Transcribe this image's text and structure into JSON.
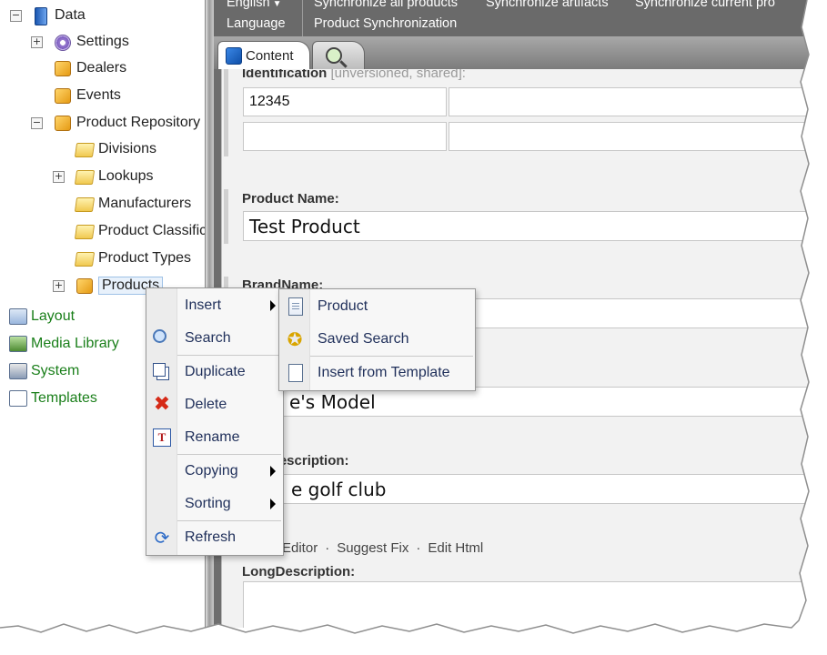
{
  "tree": {
    "items": [
      {
        "label": "Data",
        "icon": "database-icon"
      },
      {
        "label": "Settings",
        "icon": "settings-icon"
      },
      {
        "label": "Dealers",
        "icon": "package-icon"
      },
      {
        "label": "Events",
        "icon": "package-icon"
      },
      {
        "label": "Product Repository",
        "icon": "package-icon"
      },
      {
        "label": "Divisions",
        "icon": "folder-icon"
      },
      {
        "label": "Lookups",
        "icon": "folder-icon"
      },
      {
        "label": "Manufacturers",
        "icon": "folder-icon"
      },
      {
        "label": "Product Classific",
        "icon": "folder-icon"
      },
      {
        "label": "Product Types",
        "icon": "folder-icon"
      },
      {
        "label": "Products",
        "icon": "package-icon"
      }
    ],
    "roots": [
      {
        "label": "Layout",
        "icon": "layout-icon"
      },
      {
        "label": "Media Library",
        "icon": "media-library-icon"
      },
      {
        "label": "System",
        "icon": "system-icon"
      },
      {
        "label": "Templates",
        "icon": "templates-icon"
      }
    ]
  },
  "toolbar": {
    "language_value": "English",
    "sync_all": "Synchronize all products",
    "sync_artifacts": "Synchronize artifacts",
    "sync_current": "Synchronize current pro",
    "group_language": "Language",
    "group_product_sync": "Product Synchronization"
  },
  "tabs": {
    "content": "Content"
  },
  "form": {
    "identification_label": "Identification",
    "identification_note": "[unversioned, shared]:",
    "identification_value": "12345",
    "product_name_label": "Product Name:",
    "product_name_value": "Test Product",
    "brandname_label": "BrandName:",
    "model_partial_value": "e's Model",
    "description_label_partial": "Description:",
    "description_partial_value": "e golf club",
    "editor_links": [
      "Editor",
      "Suggest Fix",
      "Edit Html"
    ],
    "long_description_label": "LongDescription:"
  },
  "context_menu": {
    "items": [
      {
        "label": "Insert",
        "icon": "",
        "submenu": true
      },
      {
        "label": "Search",
        "icon": "search-icon",
        "submenu": false
      },
      {
        "label": "Duplicate",
        "icon": "duplicate-icon",
        "submenu": false
      },
      {
        "label": "Delete",
        "icon": "delete-icon",
        "submenu": false
      },
      {
        "label": "Rename",
        "icon": "rename-icon",
        "submenu": false
      },
      {
        "label": "Copying",
        "icon": "",
        "submenu": true
      },
      {
        "label": "Sorting",
        "icon": "",
        "submenu": true
      },
      {
        "label": "Refresh",
        "icon": "refresh-icon",
        "submenu": false
      }
    ]
  },
  "insert_submenu": {
    "items": [
      {
        "label": "Product",
        "icon": "document-icon"
      },
      {
        "label": "Saved Search",
        "icon": "saved-search-icon"
      },
      {
        "label": "Insert from Template",
        "icon": "blank-document-icon"
      }
    ]
  },
  "colors": {
    "tree_link_green": "#1a7f1a",
    "toolbar_bg": "#6a6a6a",
    "menu_text": "#1f2f5a"
  }
}
